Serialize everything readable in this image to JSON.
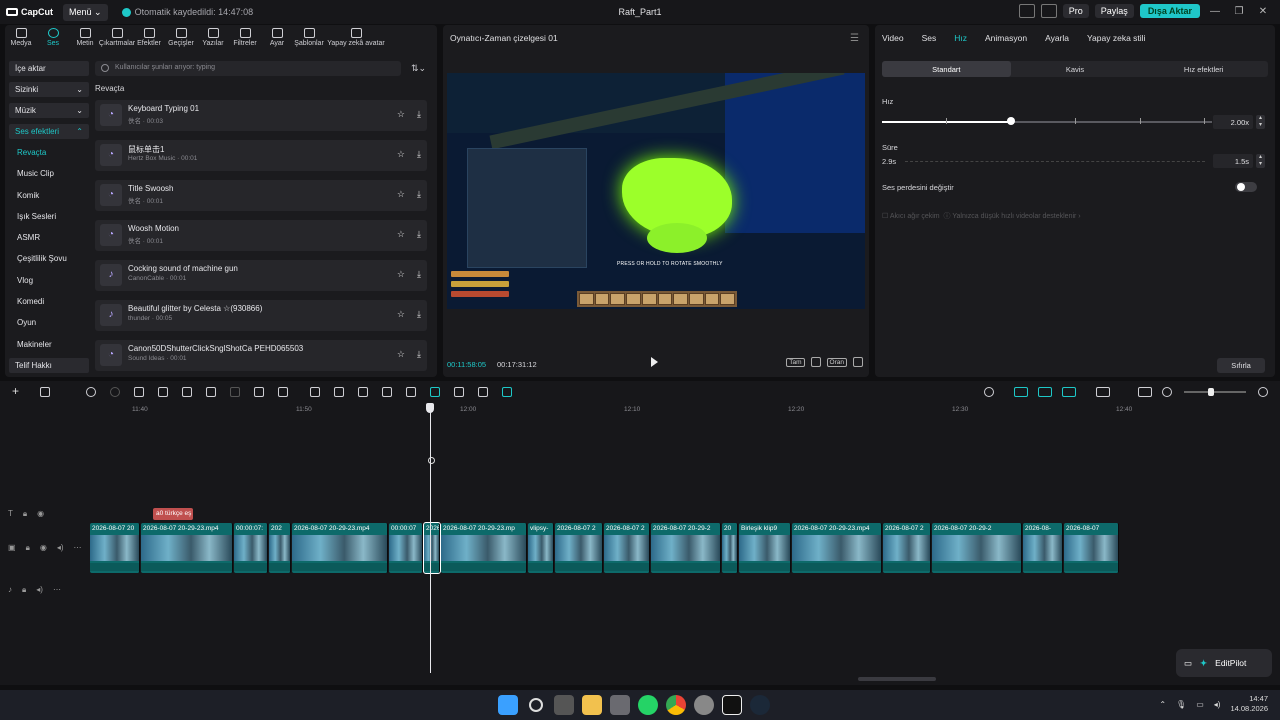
{
  "titlebar": {
    "app_name": "CapCut",
    "menu_label": "Menü",
    "autosave_text": "Otomatik kaydedildi: 14:47:08",
    "project_title": "Raft_Part1",
    "pro_label": "Pro",
    "share_label": "Paylaş",
    "export_label": "Dışa Aktar"
  },
  "toolbar": {
    "items": [
      {
        "label": "Medya",
        "icon": "media-icon"
      },
      {
        "label": "Ses",
        "icon": "audio-icon"
      },
      {
        "label": "Metin",
        "icon": "text-icon"
      },
      {
        "label": "Çıkartmalar",
        "icon": "sticker-icon"
      },
      {
        "label": "Efektler",
        "icon": "effects-icon"
      },
      {
        "label": "Geçişler",
        "icon": "transitions-icon"
      },
      {
        "label": "Yazılar",
        "icon": "captions-icon"
      },
      {
        "label": "Filtreler",
        "icon": "filters-icon"
      },
      {
        "label": "Ayar",
        "icon": "adjust-icon"
      },
      {
        "label": "Şablonlar",
        "icon": "templates-icon"
      },
      {
        "label": "Yapay zekâ avatar",
        "icon": "ai-avatar-icon"
      }
    ],
    "active_index": 1
  },
  "sidebar": {
    "import": "İçe aktar",
    "yours": "Sizinki",
    "music": "Müzik",
    "sound_effects": "Ses efektleri",
    "subcategories": [
      "Revaçta",
      "Music Clip",
      "Komik",
      "Işık Sesleri",
      "ASMR",
      "Çeşitlilik Şovu",
      "Vlog",
      "Komedi",
      "Oyun",
      "Makineler"
    ],
    "copyright": "Telif Hakkı"
  },
  "search": {
    "placeholder": "Kullanıcılar şunları arıyor: typing"
  },
  "section_title": "Revaçta",
  "sounds": [
    {
      "name": "Keyboard Typing 01",
      "meta": "佚名 · 00:03"
    },
    {
      "name": "鼠标单击1",
      "meta": "Hertz Box Music · 00:01"
    },
    {
      "name": "Title Swoosh",
      "meta": "佚名 · 00:01"
    },
    {
      "name": "Woosh Motion",
      "meta": "佚名 · 00:01"
    },
    {
      "name": "Cocking sound of machine gun",
      "meta": "CanonCable · 00:01"
    },
    {
      "name": "Beautiful glitter by Celesta ☆(930866)",
      "meta": "thunder · 00:05"
    },
    {
      "name": "Canon50DShutterClickSnglShotCa PEHD065503",
      "meta": "Sound Ideas · 00:01"
    }
  ],
  "player": {
    "title": "Oynatıcı-Zaman çizelgesi 01",
    "current_time": "00:11:58:05",
    "total_time": "00:17:31:12",
    "full_label": "Tam",
    "ratio_label": "Oran",
    "game_hint": "PRESS OR HOLD TO ROTATE SMOOTHLY"
  },
  "properties": {
    "tabs": [
      "Video",
      "Ses",
      "Hız",
      "Animasyon",
      "Ayarla",
      "Yapay zeka stili"
    ],
    "active_tab": 2,
    "mode_tabs": [
      "Standart",
      "Kavis",
      "Hız efektleri"
    ],
    "speed_label": "Hız",
    "speed_value": "2.00x",
    "speed_fraction": 0.39,
    "duration_label": "Süre",
    "duration_original": "2.9s",
    "duration_value": "1.5s",
    "pitch_label": "Ses perdesini değiştir",
    "smooth_label": "Akıcı ağır çekim",
    "smooth_note": "Yalnızca düşük hızlı videolar desteklenir",
    "reset_label": "Sıfırla"
  },
  "timeline": {
    "ruler": [
      "11:40",
      "11:50",
      "12:00",
      "12:10",
      "12:20",
      "12:30",
      "12:40"
    ],
    "text_clip": "a0 türkçe eş",
    "clips": [
      {
        "label": "2026-08-07 20"
      },
      {
        "label": "2026-08-07 20-29-23.mp4"
      },
      {
        "label": "00:00:07:"
      },
      {
        "label": "202"
      },
      {
        "label": "2026-08-07 20-29-23.mp4"
      },
      {
        "label": "00:00:07"
      },
      {
        "label": "2026"
      },
      {
        "label": "2026-08-07 20-29-23.mp"
      },
      {
        "label": "vlipsy-"
      },
      {
        "label": "2026-08-07 2"
      },
      {
        "label": "2026-08-07 2"
      },
      {
        "label": "2026-08-07 20-29-2"
      },
      {
        "label": "20"
      },
      {
        "label": "Birleşik klip9"
      },
      {
        "label": "2026-08-07 20-29-23.mp4"
      },
      {
        "label": "2026-08-07 2"
      },
      {
        "label": "2026-08-07 20-29-2"
      },
      {
        "label": "2026-08-"
      },
      {
        "label": "2026-08-07"
      }
    ]
  },
  "editpilot": "EditPilot",
  "taskbar": {
    "time": "14:47",
    "date": "14.08.2026"
  }
}
